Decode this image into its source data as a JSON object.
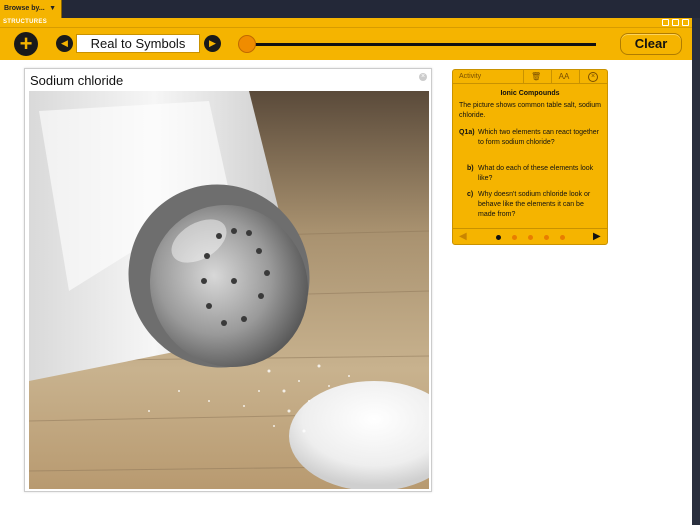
{
  "topbar": {
    "browse_label": "Browse by...",
    "browse_arrow_icon": "triangle-down-icon"
  },
  "app": {
    "title": "STRUCTURES",
    "toolbar": {
      "add_icon": "plus-icon",
      "prev_icon": "triangle-left-icon",
      "mode_label": "Real to Symbols",
      "next_icon": "triangle-right-icon",
      "slider_value": 0,
      "clear_label": "Clear"
    }
  },
  "image_panel": {
    "title": "Sodium chloride",
    "close_icon": "close-icon"
  },
  "activity": {
    "label": "Activity",
    "trash_icon": "trash-icon",
    "text_size_label": "AA",
    "close_icon": "close-icon",
    "title": "Ionic Compounds",
    "intro": "The picture shows common table salt, sodium chloride.",
    "questions": [
      {
        "num": "Q1a)",
        "text": "Which two elements can react together to form sodium chloride?"
      },
      {
        "num": "b)",
        "text": "What do each of these elements look like?"
      },
      {
        "num": "c)",
        "text": "Why doesn't sodium chloride look or behave like the elements it can be made from?"
      }
    ],
    "pagination": {
      "total": 5,
      "current": 1
    },
    "colors": {
      "accent": "#f5b400",
      "dot": "#e87d00",
      "dot_active": "#111111"
    }
  }
}
